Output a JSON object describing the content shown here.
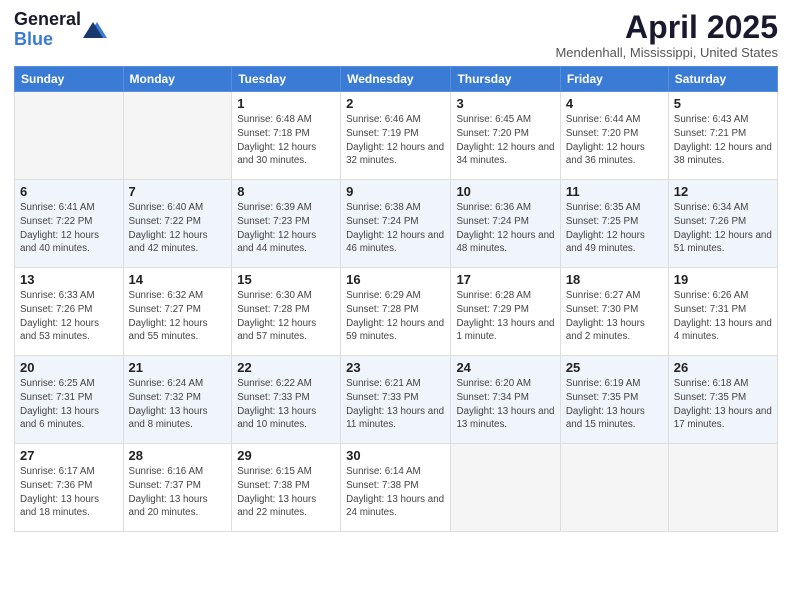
{
  "header": {
    "logo_general": "General",
    "logo_blue": "Blue",
    "month_year": "April 2025",
    "location": "Mendenhall, Mississippi, United States"
  },
  "days_of_week": [
    "Sunday",
    "Monday",
    "Tuesday",
    "Wednesday",
    "Thursday",
    "Friday",
    "Saturday"
  ],
  "weeks": [
    [
      {
        "day": "",
        "info": ""
      },
      {
        "day": "",
        "info": ""
      },
      {
        "day": "1",
        "info": "Sunrise: 6:48 AM\nSunset: 7:18 PM\nDaylight: 12 hours and 30 minutes."
      },
      {
        "day": "2",
        "info": "Sunrise: 6:46 AM\nSunset: 7:19 PM\nDaylight: 12 hours and 32 minutes."
      },
      {
        "day": "3",
        "info": "Sunrise: 6:45 AM\nSunset: 7:20 PM\nDaylight: 12 hours and 34 minutes."
      },
      {
        "day": "4",
        "info": "Sunrise: 6:44 AM\nSunset: 7:20 PM\nDaylight: 12 hours and 36 minutes."
      },
      {
        "day": "5",
        "info": "Sunrise: 6:43 AM\nSunset: 7:21 PM\nDaylight: 12 hours and 38 minutes."
      }
    ],
    [
      {
        "day": "6",
        "info": "Sunrise: 6:41 AM\nSunset: 7:22 PM\nDaylight: 12 hours and 40 minutes."
      },
      {
        "day": "7",
        "info": "Sunrise: 6:40 AM\nSunset: 7:22 PM\nDaylight: 12 hours and 42 minutes."
      },
      {
        "day": "8",
        "info": "Sunrise: 6:39 AM\nSunset: 7:23 PM\nDaylight: 12 hours and 44 minutes."
      },
      {
        "day": "9",
        "info": "Sunrise: 6:38 AM\nSunset: 7:24 PM\nDaylight: 12 hours and 46 minutes."
      },
      {
        "day": "10",
        "info": "Sunrise: 6:36 AM\nSunset: 7:24 PM\nDaylight: 12 hours and 48 minutes."
      },
      {
        "day": "11",
        "info": "Sunrise: 6:35 AM\nSunset: 7:25 PM\nDaylight: 12 hours and 49 minutes."
      },
      {
        "day": "12",
        "info": "Sunrise: 6:34 AM\nSunset: 7:26 PM\nDaylight: 12 hours and 51 minutes."
      }
    ],
    [
      {
        "day": "13",
        "info": "Sunrise: 6:33 AM\nSunset: 7:26 PM\nDaylight: 12 hours and 53 minutes."
      },
      {
        "day": "14",
        "info": "Sunrise: 6:32 AM\nSunset: 7:27 PM\nDaylight: 12 hours and 55 minutes."
      },
      {
        "day": "15",
        "info": "Sunrise: 6:30 AM\nSunset: 7:28 PM\nDaylight: 12 hours and 57 minutes."
      },
      {
        "day": "16",
        "info": "Sunrise: 6:29 AM\nSunset: 7:28 PM\nDaylight: 12 hours and 59 minutes."
      },
      {
        "day": "17",
        "info": "Sunrise: 6:28 AM\nSunset: 7:29 PM\nDaylight: 13 hours and 1 minute."
      },
      {
        "day": "18",
        "info": "Sunrise: 6:27 AM\nSunset: 7:30 PM\nDaylight: 13 hours and 2 minutes."
      },
      {
        "day": "19",
        "info": "Sunrise: 6:26 AM\nSunset: 7:31 PM\nDaylight: 13 hours and 4 minutes."
      }
    ],
    [
      {
        "day": "20",
        "info": "Sunrise: 6:25 AM\nSunset: 7:31 PM\nDaylight: 13 hours and 6 minutes."
      },
      {
        "day": "21",
        "info": "Sunrise: 6:24 AM\nSunset: 7:32 PM\nDaylight: 13 hours and 8 minutes."
      },
      {
        "day": "22",
        "info": "Sunrise: 6:22 AM\nSunset: 7:33 PM\nDaylight: 13 hours and 10 minutes."
      },
      {
        "day": "23",
        "info": "Sunrise: 6:21 AM\nSunset: 7:33 PM\nDaylight: 13 hours and 11 minutes."
      },
      {
        "day": "24",
        "info": "Sunrise: 6:20 AM\nSunset: 7:34 PM\nDaylight: 13 hours and 13 minutes."
      },
      {
        "day": "25",
        "info": "Sunrise: 6:19 AM\nSunset: 7:35 PM\nDaylight: 13 hours and 15 minutes."
      },
      {
        "day": "26",
        "info": "Sunrise: 6:18 AM\nSunset: 7:35 PM\nDaylight: 13 hours and 17 minutes."
      }
    ],
    [
      {
        "day": "27",
        "info": "Sunrise: 6:17 AM\nSunset: 7:36 PM\nDaylight: 13 hours and 18 minutes."
      },
      {
        "day": "28",
        "info": "Sunrise: 6:16 AM\nSunset: 7:37 PM\nDaylight: 13 hours and 20 minutes."
      },
      {
        "day": "29",
        "info": "Sunrise: 6:15 AM\nSunset: 7:38 PM\nDaylight: 13 hours and 22 minutes."
      },
      {
        "day": "30",
        "info": "Sunrise: 6:14 AM\nSunset: 7:38 PM\nDaylight: 13 hours and 24 minutes."
      },
      {
        "day": "",
        "info": ""
      },
      {
        "day": "",
        "info": ""
      },
      {
        "day": "",
        "info": ""
      }
    ]
  ]
}
